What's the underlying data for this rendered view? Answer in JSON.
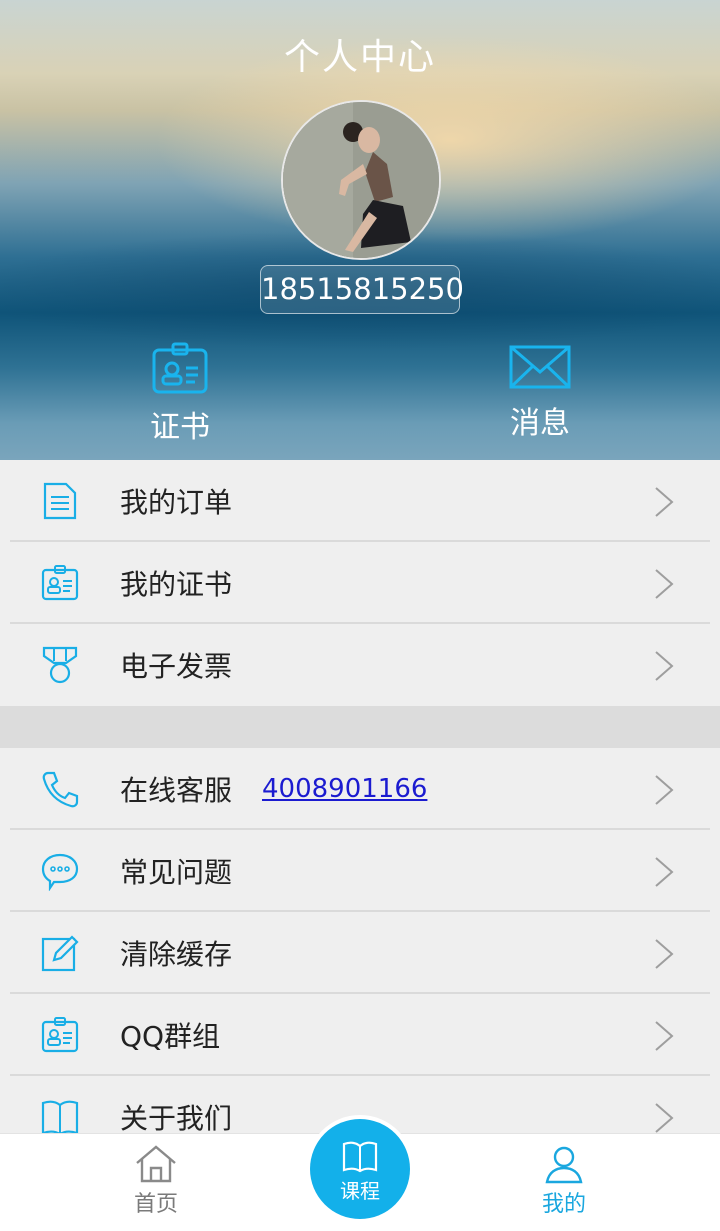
{
  "header": {
    "title": "个人中心",
    "phone": "18515815250",
    "quick_actions": [
      {
        "label": "证书",
        "icon": "certificate-icon"
      },
      {
        "label": "消息",
        "icon": "envelope-icon"
      }
    ]
  },
  "menu_primary": [
    {
      "label": "我的订单",
      "icon": "document-icon"
    },
    {
      "label": "我的证书",
      "icon": "certificate-icon"
    },
    {
      "label": "电子发票",
      "icon": "medal-icon"
    }
  ],
  "menu_secondary": [
    {
      "label": "在线客服",
      "icon": "phone-icon",
      "link": "4008901166"
    },
    {
      "label": "常见问题",
      "icon": "chat-bubble-icon"
    },
    {
      "label": "清除缓存",
      "icon": "edit-icon"
    },
    {
      "label": "QQ群组",
      "icon": "certificate-icon"
    },
    {
      "label": "关于我们",
      "icon": "book-icon"
    }
  ],
  "tabbar": {
    "home": "首页",
    "course": "课程",
    "mine": "我的",
    "active": "mine"
  },
  "colors": {
    "accent": "#1aa7df",
    "course_button": "#13b0ea",
    "link": "#1b1bd0"
  }
}
